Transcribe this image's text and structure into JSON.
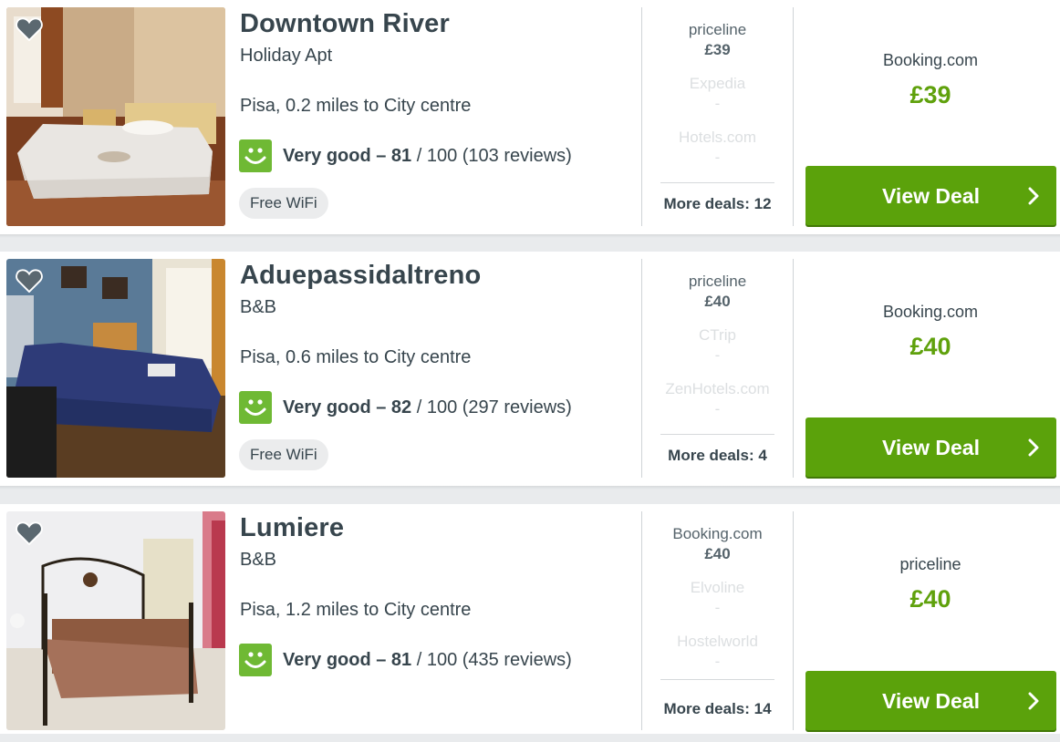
{
  "colors": {
    "accent_green": "#5ba20b",
    "price_green": "#5fa10c",
    "smiley_green": "#6fb934",
    "text": "#37454d"
  },
  "icons": {
    "favorite": "heart-icon",
    "rating": "smiley-icon",
    "button": "chevron-right-icon"
  },
  "hotels": [
    {
      "name": "Downtown River",
      "type": "Holiday Apt",
      "location": "Pisa, 0.2 miles to City centre",
      "rating_label": "Very good – 81",
      "rating_rest": " / 100 (103 reviews)",
      "amenity": "Free WiFi",
      "alternatives": [
        {
          "site": "priceline",
          "price": "£39"
        },
        {
          "site": "Expedia",
          "price": "-"
        },
        {
          "site": "Hotels.com",
          "price": "-"
        }
      ],
      "more_deals": "More deals: 12",
      "best_site": "Booking.com",
      "best_price": "£39",
      "cta": "View Deal"
    },
    {
      "name": "Aduepassidaltreno",
      "type": "B&B",
      "location": "Pisa, 0.6 miles to City centre",
      "rating_label": "Very good – 82",
      "rating_rest": " / 100 (297 reviews)",
      "amenity": "Free WiFi",
      "alternatives": [
        {
          "site": "priceline",
          "price": "£40"
        },
        {
          "site": "CTrip",
          "price": "-"
        },
        {
          "site": "ZenHotels.com",
          "price": "-"
        }
      ],
      "more_deals": "More deals: 4",
      "best_site": "Booking.com",
      "best_price": "£40",
      "cta": "View Deal"
    },
    {
      "name": "Lumiere",
      "type": "B&B",
      "location": "Pisa, 1.2 miles to City centre",
      "rating_label": "Very good – 81",
      "rating_rest": " / 100 (435 reviews)",
      "amenity": "",
      "alternatives": [
        {
          "site": "Booking.com",
          "price": "£40"
        },
        {
          "site": "Elvoline",
          "price": "-"
        },
        {
          "site": "Hostelworld",
          "price": "-"
        }
      ],
      "more_deals": "More deals: 14",
      "best_site": "priceline",
      "best_price": "£40",
      "cta": "View Deal"
    }
  ]
}
